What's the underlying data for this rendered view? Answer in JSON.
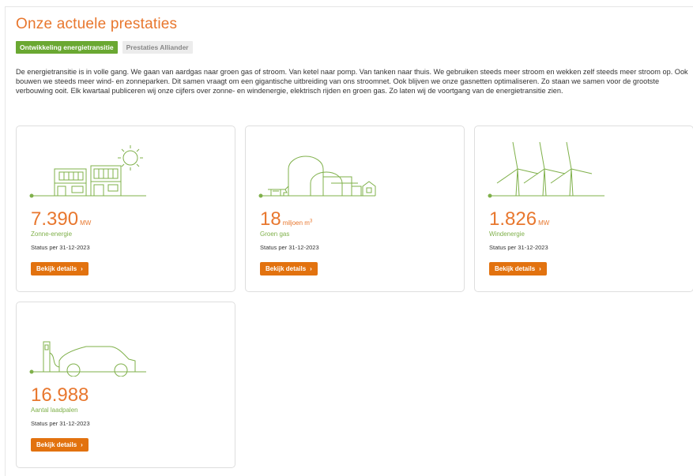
{
  "page_title": "Onze actuele prestaties",
  "tabs": [
    {
      "label": "Ontwikkeling energietransitie",
      "active": true
    },
    {
      "label": "Prestaties Alliander",
      "active": false
    }
  ],
  "intro": "De energietransitie is in volle gang. We gaan van aardgas naar groen gas of stroom. Van ketel naar pomp. Van tanken naar thuis. We gebruiken steeds meer stroom en wekken zelf steeds meer stroom op. Ook bouwen we steeds meer wind- en zonneparken. Dit samen vraagt om een gigantische uitbreiding van ons stroomnet. Ook blijven we onze gasnetten optimaliseren. Zo staan we samen voor de grootste verbouwing ooit. Elk kwartaal publiceren wij onze cijfers over zonne- en windenergie, elektrisch rijden en groen gas. Zo laten wij de voortgang van de energietransitie zien.",
  "colors": {
    "accent": "#e8772e",
    "green": "#7fb04a",
    "tab_active": "#6aa832",
    "button": "#e2720f"
  },
  "cards": [
    {
      "icon": "solar-houses-icon",
      "value": "7.390",
      "unit": "MW",
      "label": "Zonne-energie",
      "status": "Status per 31-12-2023",
      "button": "Bekijk details"
    },
    {
      "icon": "biogas-farm-icon",
      "value": "18",
      "unit": "miljoen m",
      "unit_sup": "3",
      "label": "Groen gas",
      "status": "Status per 31-12-2023",
      "button": "Bekijk details"
    },
    {
      "icon": "wind-turbines-icon",
      "value": "1.826",
      "unit": "MW",
      "label": "Windenergie",
      "status": "Status per 31-12-2023",
      "button": "Bekijk details"
    },
    {
      "icon": "ev-charging-icon",
      "value": "16.988",
      "unit": "",
      "label": "Aantal laadpalen",
      "status": "Status per 31-12-2023",
      "button": "Bekijk details"
    }
  ],
  "chevron": "›"
}
